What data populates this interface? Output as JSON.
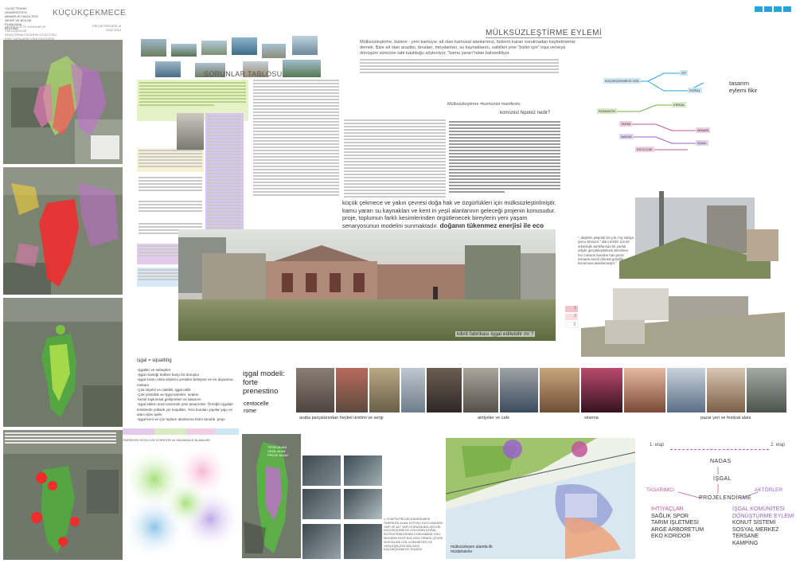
{
  "header": {
    "title": "KÜÇÜKÇEKMECE",
    "left_info": [
      "YILDIZ TEKNİK ÜNİVERSİTESİ",
      "MİMARLIK FAKÜLTESİ",
      "ŞEHİR VE BÖLGE PLANLAMA",
      "BÖLÜMÜ"
    ],
    "left_info2": [
      "ŞEHİRCİLİKTE KAVRAM VE YAKLAŞIMLAR",
      "ARAŞTIRMA/TASARIM STÜDYOSU",
      "ESKİ YAPILARIN YENİ İŞLEVLERİ"
    ],
    "right_info": [
      "PROJE PROJESİ III",
      "GÜZ 2013"
    ],
    "squares_colors": [
      "#2aa3d8",
      "#2aa3d8",
      "#2aa3d8",
      "#2aa3d8"
    ]
  },
  "main_title": "MÜLKSÜZLEŞTİRME EYLEMİ",
  "intro_text": "Mülksüzleştirme, bizlere - yeni kamuya- ait olan kamusal alanlarımız, bizlerin kararı sorulmadan kaybetmemiz demek. Bize ait olan araziler, binaları, meydanları, su kaynaklarını, sahilleri yine \"bizler için\" inşa ve/veya dönüşüm sürecine tabi tutulduğu söyleniyor, \"kamu yararı\"ndan bahsediliyor.",
  "sorunlar_title": "SORUNLAR TABLOSU",
  "manifesto": {
    "heading": "Mülksüzleştirme =komünist manifesto",
    "question": "komünist hipotez nedir?"
  },
  "big_statement": {
    "normal": "küçük çekmece ve yakın çevresi doğa hak ve özgürlükleri için mülksüzleştirilmiştir. kamu yararı su kaynakları ve kent in yeşil alanlarının geleceği projenin konusudur. proje, toplumun farklı kesimlerinden örgütlenecek bireylerin yeni yaşam senaryosunun modelini sunmaktadır. ",
    "bold": "doğanın tükenmez enerjisi ile eco modern şehirler tasarlamak nasıl mümkün olabilir ?"
  },
  "panorama_caption": "kibrit fabrikası işgal edilebilir mi ?",
  "flow_title": "tasarım eylemi fikir",
  "quote_right": "\"..düşlerin peşinde bir çok ı hiç sahiya iyonu olmuyor.\" alanı üretim için de arkeolojik varlıklarında bir yardık izdiyle gerçekleştirilmek istenirken her mimarın kendine has gezici mimarisi kendi zihinsel güzellik konumuna tasarlanmıştır.\"",
  "side_numbers": [
    "1",
    "2",
    "3"
  ],
  "isgal": {
    "formula": "işgal = squatting",
    "items": [
      "-işgaller ve sebepleri",
      "-işgal mantığı kültüre karşı bir duruştur",
      "-işgal sıranı olma söylemi yeniden birleşme ve en dayanma mekanı",
      "-Çok ölçekli ve nitelikli, işgal edilir",
      "-Çok yönlülük ve işgal edenler, nedeni",
      "-kendi toplumsal gelişmeleri ve tasarımı",
      "-işgal edilen arazi üzerinde yeni tasarımlar: Örneğin işgalde tesislerde yüksek yer koşulları, Yeni kurulan yapılar yapı ve alanı işlev şarkı",
      "-işgal kent ve için toplum alanlarına birim tanıdık, proje"
    ],
    "model_title": "işgal modeli: forte prenestino",
    "model_place": "centocelle rome"
  },
  "strip_captions": {
    "araba": "araba parçalarından heykel üretimi ve sergi",
    "atolye": "atölyeler ve cafe",
    "sinema": "sinema",
    "pazar": "pazar yeri ve festival alanı"
  },
  "bottom_left_label": "ÖNERİLEN EKOLOJİK KORİDOR ve MÜDAHALE ALANLARI",
  "bottom_caption": "1. ETAPTA PROJELENDİRİLMESİ ÖNERİLEN ALAN; İHTİYAÇ DUYULMASINI YAPI VE ALT YAPI KORUMA BÖLGELERİ KÜÇÜKÇEKMECE GÖLÜNÜN DOĞAL EKOSİSTEMLERİNİN KORUNMASI; EKO MODERN KENT BÖLGESİ ÖRNEK ÇEVRE NOKTALARI GÖL KOMUNİTESİ VE YERLEŞİKLERİ BÖLGESİ KÜÇÜKÇEKMECE ÖNLEMİ",
  "site_label": "mülksüzleşen alanda ilk müdahaleler",
  "labels_map": [
    "TESİS ALANI",
    "YEŞİL ALAN",
    "PROJE ALANI"
  ],
  "stages": {
    "etap1": "1. etap",
    "etap2": "2. etap",
    "nadas": "NADAS",
    "isgal": "İŞGAL",
    "tasarimci": "TASARIMCI",
    "aktorler": "AKTÖRLER",
    "projelendirme": "PROJELENDİRME",
    "needs": [
      "İHTİYAÇLAR",
      "SAĞLIK SPOR",
      "TARIM İŞLETMESİ",
      "ARGE ARBORETUM",
      "EKO KORİDOR"
    ],
    "community": [
      "İŞGAL KOMÜNİTESİ",
      "DÖNÜŞTÜRME EYLEMİ",
      "KONUT SİSTEMİ",
      "SOSYAL MERKEZ",
      "TERSANE",
      "KAMPİNG"
    ]
  },
  "flow_boxes": [
    "KÜÇÜKÇEKMECE GÖL",
    "SİT",
    "DOĞAL",
    "KIRSAL",
    "ROMANTİK",
    "TARIM",
    "MİMARİ",
    "NADAS",
    "İŞGAL",
    "EKOLOJİK",
    "MERKEZİ",
    "ÇEVRE DÜZENİ",
    "SOSYAL",
    "EKOLOJİK DÖNÜŞÜM"
  ],
  "colors": {
    "accent_pink": "#c0579a",
    "accent_purple": "#9a64c9",
    "accent_green": "#6ab04c",
    "sky_blue": "#2aa3d8"
  }
}
